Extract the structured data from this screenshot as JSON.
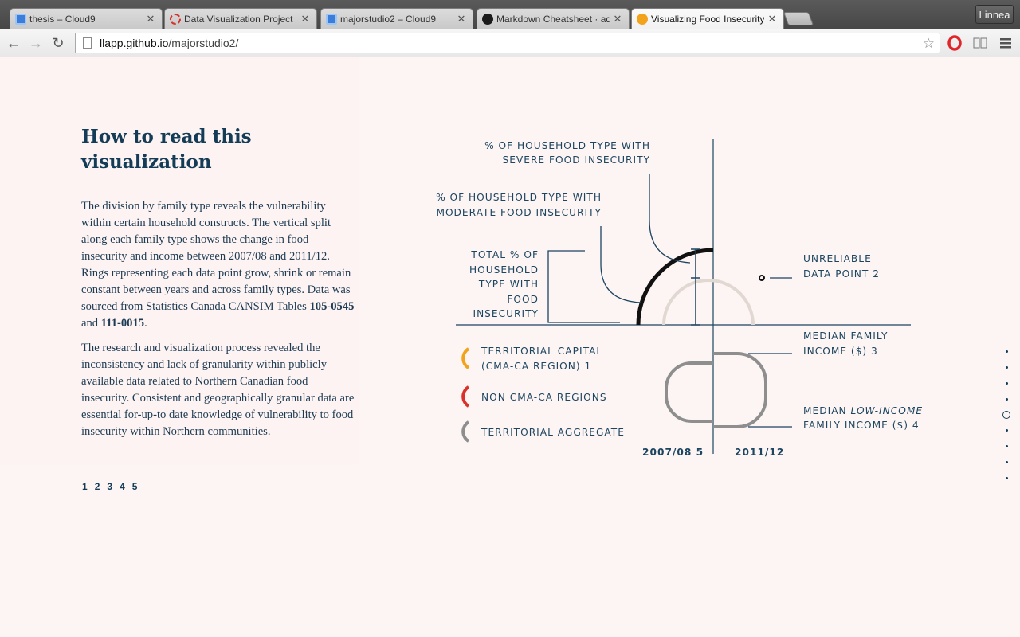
{
  "browser": {
    "tabs": [
      {
        "title": "thesis – Cloud9",
        "icon": "cloud9-icon"
      },
      {
        "title": "Data Visualization Project",
        "icon": "project-icon"
      },
      {
        "title": "majorstudio2 – Cloud9",
        "icon": "cloud9-icon"
      },
      {
        "title": "Markdown Cheatsheet · ad",
        "icon": "github-icon"
      },
      {
        "title": "Visualizing Food Insecurity",
        "icon": "orange-circle-icon"
      }
    ],
    "profile_name": "Linnea",
    "url_host": "llapp.github.io",
    "url_path": "/majorstudio2/"
  },
  "page": {
    "heading": "How to read this visualization",
    "paragraph1_text": "The division by family type reveals the vulnerability within certain household constructs. The vertical split along each family type shows the change in food insecurity and income between 2007/08 and 2011/12. Rings representing each data point grow, shrink or remain constant between years and across family types. Data was sourced from Statistics Canada CANSIM Tables ",
    "table1": "105-0545",
    "and_word": " and ",
    "table2": "111-0015",
    "period": ".",
    "paragraph2": "The research and visualization process revealed the inconsistency and lack of granularity within publicly available data related to Northern Canadian food insecurity. Consistent and geographically granular data are essential for-up-to date knowledge of vulnerability to food insecurity within Northern communities.",
    "pager": [
      "1",
      "2",
      "3",
      "4",
      "5"
    ]
  },
  "legend": {
    "severe_line1": "% OF HOUSEHOLD TYPE WITH",
    "severe_line2": "SEVERE FOOD INSECURITY",
    "moderate_line1": "% OF HOUSEHOLD TYPE WITH",
    "moderate_line2": "MODERATE FOOD INSECURITY",
    "total_lines": [
      "TOTAL % OF",
      "HOUSEHOLD",
      "TYPE WITH",
      "FOOD",
      "INSECURITY"
    ],
    "unreliable_line1": "UNRELIABLE",
    "unreliable_line2": "DATA POINT 2",
    "median_line1": "MEDIAN FAMILY",
    "median_line2": "INCOME ($) 3",
    "median_low_prefix": "MEDIAN ",
    "median_low_italic": "LOW-INCOME",
    "median_low_line2": "FAMILY INCOME ($) 4",
    "capital_line1": "TERRITORIAL CAPITAL",
    "capital_line2": "(CMA-CA REGION) 1",
    "non_cma": "NON CMA-CA REGIONS",
    "aggregate": "TERRITORIAL AGGREGATE",
    "year_left": "2007/08 5",
    "year_right": "2011/12",
    "colors": {
      "capital": "#f3a31b",
      "non_cma": "#d8322b",
      "aggregate": "#8e8e8e",
      "ink": "#1d4560"
    }
  }
}
